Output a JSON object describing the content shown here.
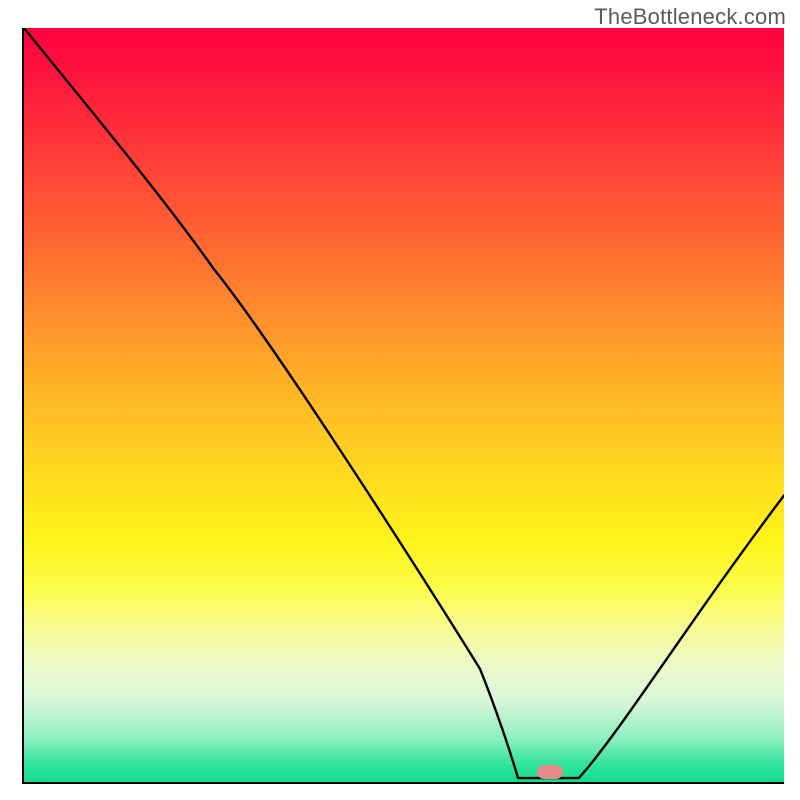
{
  "watermark": "TheBottleneck.com",
  "gradient": {
    "stops": [
      {
        "pos": 0,
        "color": "#ff003f"
      },
      {
        "pos": 0.07,
        "color": "#ff173d"
      },
      {
        "pos": 0.2,
        "color": "#ff4737"
      },
      {
        "pos": 0.33,
        "color": "#ff7a2f"
      },
      {
        "pos": 0.46,
        "color": "#ffad27"
      },
      {
        "pos": 0.59,
        "color": "#ffd91f"
      },
      {
        "pos": 0.68,
        "color": "#fff41a"
      },
      {
        "pos": 0.74,
        "color": "#fcfc47"
      },
      {
        "pos": 0.79,
        "color": "#f8fb8a"
      },
      {
        "pos": 0.84,
        "color": "#edf9c0"
      },
      {
        "pos": 0.89,
        "color": "#d4f6d4"
      },
      {
        "pos": 0.94,
        "color": "#88efbd"
      },
      {
        "pos": 0.975,
        "color": "#2de399"
      },
      {
        "pos": 1.0,
        "color": "#12dd8e"
      }
    ]
  },
  "marker": {
    "x_pct": 69.2,
    "y_pct": 98.7,
    "color": "#e58b8b"
  },
  "chart_data": {
    "type": "line",
    "title": "",
    "xlabel": "",
    "ylabel": "",
    "xlim": [
      0,
      100
    ],
    "ylim": [
      0,
      100
    ],
    "series": [
      {
        "name": "curve",
        "x": [
          0,
          8,
          18,
          25,
          32,
          40,
          48,
          55,
          60,
          64,
          67,
          70,
          73,
          76,
          80,
          85,
          90,
          95,
          100
        ],
        "value": [
          100,
          88,
          76,
          68,
          60,
          50,
          40,
          30,
          22,
          13,
          5,
          1,
          0,
          1,
          5,
          12,
          20,
          29,
          38
        ]
      }
    ],
    "flat_segment": {
      "x_start": 65,
      "x_end": 73,
      "value": 0
    },
    "optimum_marker": {
      "x": 69,
      "value": 0
    }
  }
}
